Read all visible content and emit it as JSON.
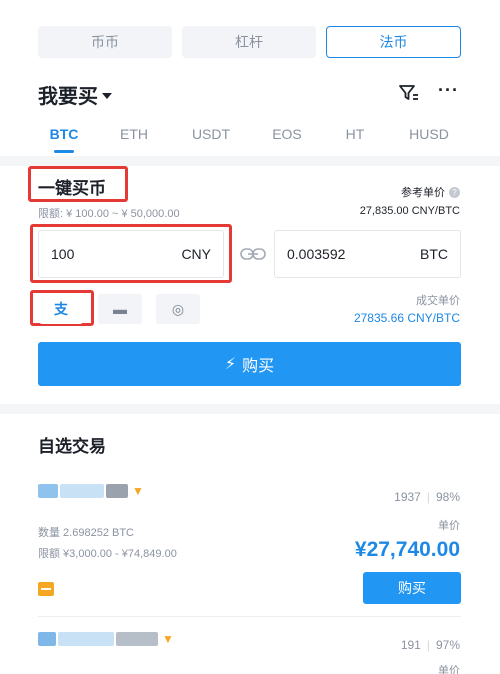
{
  "top_tabs": [
    {
      "label": "币币",
      "active": false
    },
    {
      "label": "杠杆",
      "active": false
    },
    {
      "label": "法币",
      "active": true
    }
  ],
  "header": {
    "title": "我要买",
    "filter_icon": "filter-icon",
    "more_icon": "more-icon",
    "more_glyph": "···"
  },
  "coin_tabs": [
    "BTC",
    "ETH",
    "USDT",
    "EOS",
    "HT",
    "HUSD"
  ],
  "quick_buy": {
    "title": "一键买币",
    "limit": "限额: ¥ 100.00 ~ ¥ 50,000.00",
    "ref_price_label": "参考单价",
    "ref_price_value": "27,835.00 CNY/BTC",
    "amount_value": "100",
    "amount_unit": "CNY",
    "btc_value": "0.003592",
    "btc_unit": "BTC",
    "deal_price_label": "成交单价",
    "deal_price_value": "27835.66 CNY/BTC",
    "buy_button": "购买",
    "buy_glyph": "⚡"
  },
  "payment_methods": [
    {
      "name": "alipay-icon",
      "glyph": "支",
      "selected": true
    },
    {
      "name": "bank-card-icon",
      "glyph": "▬",
      "selected": false
    },
    {
      "name": "wechat-icon",
      "glyph": "◎",
      "selected": false
    }
  ],
  "selected_trade": {
    "title": "自选交易",
    "items": [
      {
        "orders": "1937",
        "completion": "98%",
        "quantity": "数量 2.698252 BTC",
        "limit": "限额 ¥3,000.00 - ¥74,849.00",
        "price_label": "单价",
        "price": "¥27,740.00",
        "buy_button": "购买"
      },
      {
        "orders": "191",
        "completion": "97%",
        "price_label": "单价"
      }
    ]
  },
  "colors": {
    "accent": "#1e88e5",
    "button": "#2196f3",
    "highlight": "#e53935",
    "badge": "#f5a623"
  }
}
